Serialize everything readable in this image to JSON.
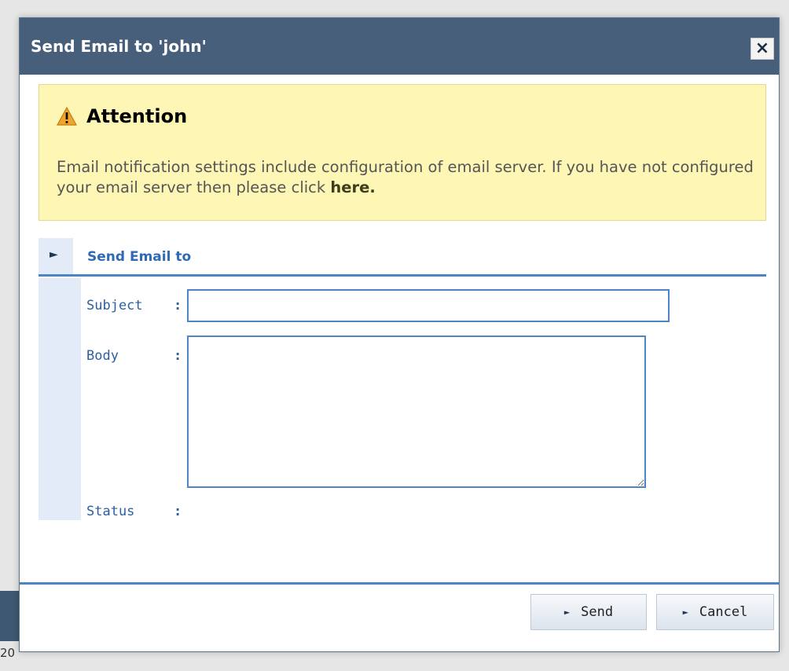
{
  "backdrop": {
    "partial_text": "20"
  },
  "dialog": {
    "title": "Send Email to 'john'",
    "close_label": "×"
  },
  "attention": {
    "icon": "warning-triangle-icon",
    "title": "Attention",
    "message": "Email notification settings include configuration of email server. If you have not configured your email server then please click",
    "link_label": "here."
  },
  "section": {
    "arrow": "►",
    "title": "Send Email to"
  },
  "form": {
    "subject_label": "Subject",
    "subject_value": "",
    "body_label": "Body",
    "body_value": "",
    "status_label": "Status",
    "status_value": "",
    "colon": ":"
  },
  "buttons": {
    "arrow": "►",
    "send_label": "Send",
    "cancel_label": "Cancel"
  },
  "colors": {
    "titlebar": "#475f7b",
    "attention_bg": "#fdf6b5",
    "accent_blue": "#4d84c4",
    "label_blue": "#2d5fa0",
    "gutter": "#e2ebf7"
  }
}
